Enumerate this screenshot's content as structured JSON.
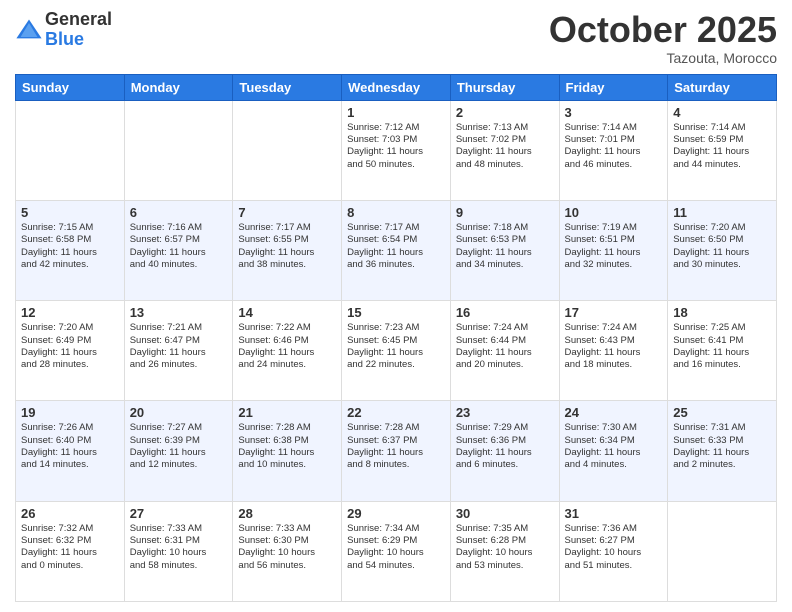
{
  "logo": {
    "general": "General",
    "blue": "Blue"
  },
  "title": "October 2025",
  "location": "Tazouta, Morocco",
  "days_of_week": [
    "Sunday",
    "Monday",
    "Tuesday",
    "Wednesday",
    "Thursday",
    "Friday",
    "Saturday"
  ],
  "weeks": [
    [
      {
        "day": "",
        "info": ""
      },
      {
        "day": "",
        "info": ""
      },
      {
        "day": "",
        "info": ""
      },
      {
        "day": "1",
        "info": "Sunrise: 7:12 AM\nSunset: 7:03 PM\nDaylight: 11 hours\nand 50 minutes."
      },
      {
        "day": "2",
        "info": "Sunrise: 7:13 AM\nSunset: 7:02 PM\nDaylight: 11 hours\nand 48 minutes."
      },
      {
        "day": "3",
        "info": "Sunrise: 7:14 AM\nSunset: 7:01 PM\nDaylight: 11 hours\nand 46 minutes."
      },
      {
        "day": "4",
        "info": "Sunrise: 7:14 AM\nSunset: 6:59 PM\nDaylight: 11 hours\nand 44 minutes."
      }
    ],
    [
      {
        "day": "5",
        "info": "Sunrise: 7:15 AM\nSunset: 6:58 PM\nDaylight: 11 hours\nand 42 minutes."
      },
      {
        "day": "6",
        "info": "Sunrise: 7:16 AM\nSunset: 6:57 PM\nDaylight: 11 hours\nand 40 minutes."
      },
      {
        "day": "7",
        "info": "Sunrise: 7:17 AM\nSunset: 6:55 PM\nDaylight: 11 hours\nand 38 minutes."
      },
      {
        "day": "8",
        "info": "Sunrise: 7:17 AM\nSunset: 6:54 PM\nDaylight: 11 hours\nand 36 minutes."
      },
      {
        "day": "9",
        "info": "Sunrise: 7:18 AM\nSunset: 6:53 PM\nDaylight: 11 hours\nand 34 minutes."
      },
      {
        "day": "10",
        "info": "Sunrise: 7:19 AM\nSunset: 6:51 PM\nDaylight: 11 hours\nand 32 minutes."
      },
      {
        "day": "11",
        "info": "Sunrise: 7:20 AM\nSunset: 6:50 PM\nDaylight: 11 hours\nand 30 minutes."
      }
    ],
    [
      {
        "day": "12",
        "info": "Sunrise: 7:20 AM\nSunset: 6:49 PM\nDaylight: 11 hours\nand 28 minutes."
      },
      {
        "day": "13",
        "info": "Sunrise: 7:21 AM\nSunset: 6:47 PM\nDaylight: 11 hours\nand 26 minutes."
      },
      {
        "day": "14",
        "info": "Sunrise: 7:22 AM\nSunset: 6:46 PM\nDaylight: 11 hours\nand 24 minutes."
      },
      {
        "day": "15",
        "info": "Sunrise: 7:23 AM\nSunset: 6:45 PM\nDaylight: 11 hours\nand 22 minutes."
      },
      {
        "day": "16",
        "info": "Sunrise: 7:24 AM\nSunset: 6:44 PM\nDaylight: 11 hours\nand 20 minutes."
      },
      {
        "day": "17",
        "info": "Sunrise: 7:24 AM\nSunset: 6:43 PM\nDaylight: 11 hours\nand 18 minutes."
      },
      {
        "day": "18",
        "info": "Sunrise: 7:25 AM\nSunset: 6:41 PM\nDaylight: 11 hours\nand 16 minutes."
      }
    ],
    [
      {
        "day": "19",
        "info": "Sunrise: 7:26 AM\nSunset: 6:40 PM\nDaylight: 11 hours\nand 14 minutes."
      },
      {
        "day": "20",
        "info": "Sunrise: 7:27 AM\nSunset: 6:39 PM\nDaylight: 11 hours\nand 12 minutes."
      },
      {
        "day": "21",
        "info": "Sunrise: 7:28 AM\nSunset: 6:38 PM\nDaylight: 11 hours\nand 10 minutes."
      },
      {
        "day": "22",
        "info": "Sunrise: 7:28 AM\nSunset: 6:37 PM\nDaylight: 11 hours\nand 8 minutes."
      },
      {
        "day": "23",
        "info": "Sunrise: 7:29 AM\nSunset: 6:36 PM\nDaylight: 11 hours\nand 6 minutes."
      },
      {
        "day": "24",
        "info": "Sunrise: 7:30 AM\nSunset: 6:34 PM\nDaylight: 11 hours\nand 4 minutes."
      },
      {
        "day": "25",
        "info": "Sunrise: 7:31 AM\nSunset: 6:33 PM\nDaylight: 11 hours\nand 2 minutes."
      }
    ],
    [
      {
        "day": "26",
        "info": "Sunrise: 7:32 AM\nSunset: 6:32 PM\nDaylight: 11 hours\nand 0 minutes."
      },
      {
        "day": "27",
        "info": "Sunrise: 7:33 AM\nSunset: 6:31 PM\nDaylight: 10 hours\nand 58 minutes."
      },
      {
        "day": "28",
        "info": "Sunrise: 7:33 AM\nSunset: 6:30 PM\nDaylight: 10 hours\nand 56 minutes."
      },
      {
        "day": "29",
        "info": "Sunrise: 7:34 AM\nSunset: 6:29 PM\nDaylight: 10 hours\nand 54 minutes."
      },
      {
        "day": "30",
        "info": "Sunrise: 7:35 AM\nSunset: 6:28 PM\nDaylight: 10 hours\nand 53 minutes."
      },
      {
        "day": "31",
        "info": "Sunrise: 7:36 AM\nSunset: 6:27 PM\nDaylight: 10 hours\nand 51 minutes."
      },
      {
        "day": "",
        "info": ""
      }
    ]
  ]
}
